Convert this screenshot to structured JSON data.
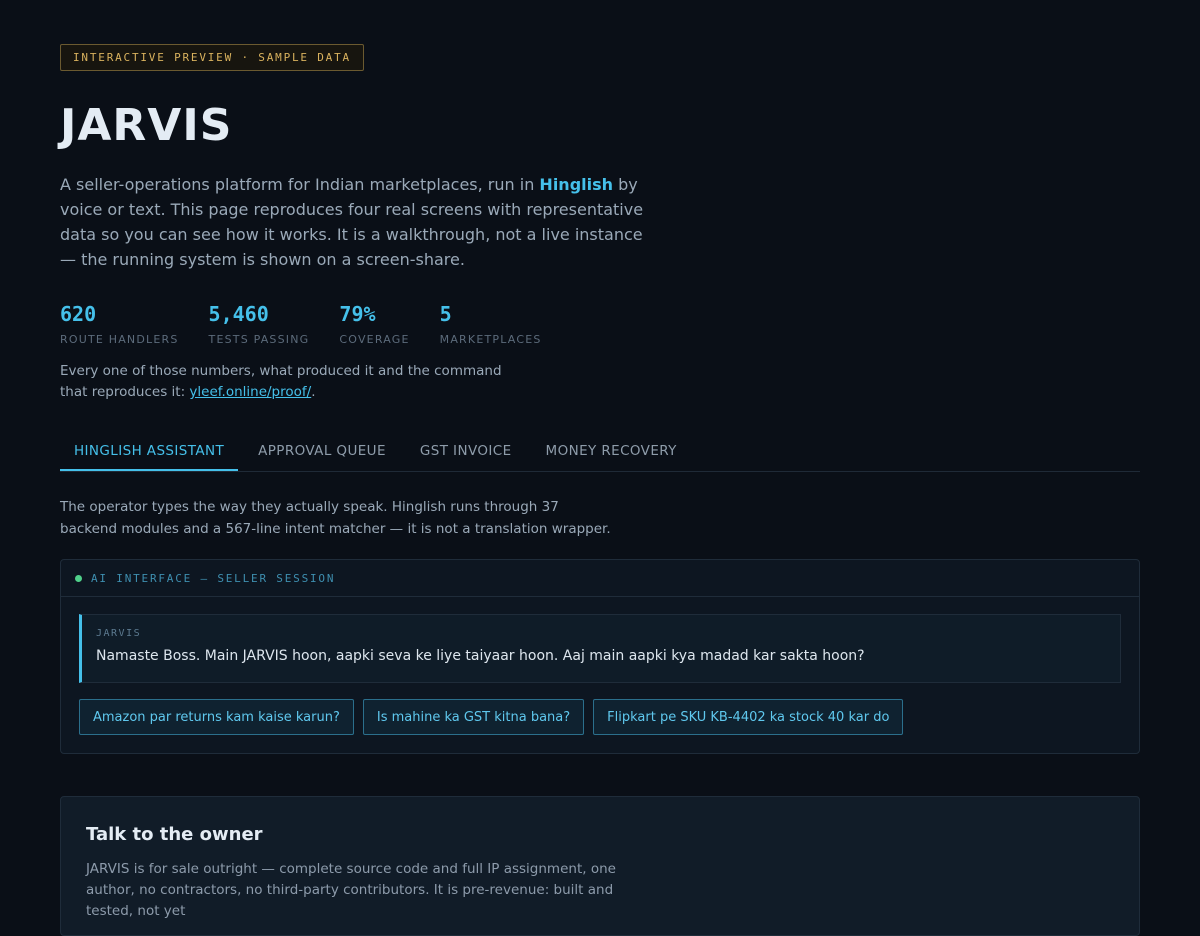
{
  "badge": "INTERACTIVE PREVIEW · SAMPLE DATA",
  "title": "JARVIS",
  "intro": {
    "before": "A seller-operations platform for Indian marketplaces, run in ",
    "highlight": "Hinglish",
    "after": " by voice or text. This page reproduces four real screens with representative data so you can see how it works. It is a walkthrough, not a live instance — the running system is shown on a screen-share."
  },
  "stats": [
    {
      "value": "620",
      "label": "ROUTE HANDLERS"
    },
    {
      "value": "5,460",
      "label": "TESTS PASSING"
    },
    {
      "value": "79%",
      "label": "COVERAGE"
    },
    {
      "value": "5",
      "label": "MARKETPLACES"
    }
  ],
  "proof": {
    "before": "Every one of those numbers, what produced it and the command that reproduces it: ",
    "link": "yleef.online/proof/",
    "after": "."
  },
  "tabs": [
    {
      "label": "HINGLISH ASSISTANT",
      "active": true
    },
    {
      "label": "APPROVAL QUEUE",
      "active": false
    },
    {
      "label": "GST INVOICE",
      "active": false
    },
    {
      "label": "MONEY RECOVERY",
      "active": false
    }
  ],
  "description": "The operator types the way they actually speak. Hinglish runs through 37 backend modules and a 567-line intent matcher — it is not a translation wrapper.",
  "panel": {
    "header": "AI INTERFACE — SELLER SESSION",
    "status_color": "#4fd08a",
    "message": {
      "from": "JARVIS",
      "text": "Namaste Boss. Main JARVIS hoon, aapki seva ke liye taiyaar hoon. Aaj main aapki kya madad kar sakta hoon?"
    },
    "suggestions": [
      "Amazon par returns kam kaise karun?",
      "Is mahine ka GST kitna bana?",
      "Flipkart pe SKU KB-4402 ka stock 40 kar do"
    ]
  },
  "owner": {
    "title": "Talk to the owner",
    "text": "JARVIS is for sale outright — complete source code and full IP assignment, one author, no contractors, no third-party contributors. It is pre-revenue: built and tested, not yet"
  },
  "colors": {
    "accent": "#45c0ea",
    "badge": "#d9b25e",
    "background": "#0a0f17"
  }
}
